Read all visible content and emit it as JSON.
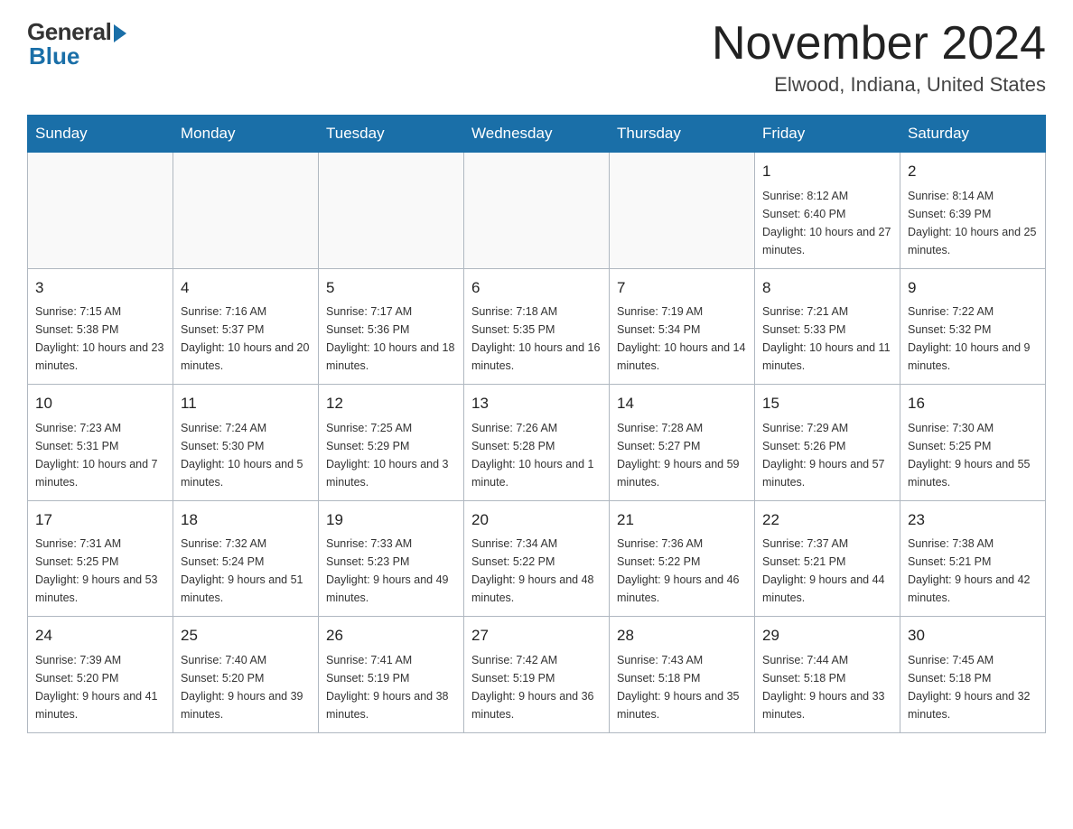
{
  "logo": {
    "general": "General",
    "blue": "Blue"
  },
  "header": {
    "month_year": "November 2024",
    "location": "Elwood, Indiana, United States"
  },
  "weekdays": [
    "Sunday",
    "Monday",
    "Tuesday",
    "Wednesday",
    "Thursday",
    "Friday",
    "Saturday"
  ],
  "weeks": [
    [
      {
        "day": "",
        "info": ""
      },
      {
        "day": "",
        "info": ""
      },
      {
        "day": "",
        "info": ""
      },
      {
        "day": "",
        "info": ""
      },
      {
        "day": "",
        "info": ""
      },
      {
        "day": "1",
        "info": "Sunrise: 8:12 AM\nSunset: 6:40 PM\nDaylight: 10 hours and 27 minutes."
      },
      {
        "day": "2",
        "info": "Sunrise: 8:14 AM\nSunset: 6:39 PM\nDaylight: 10 hours and 25 minutes."
      }
    ],
    [
      {
        "day": "3",
        "info": "Sunrise: 7:15 AM\nSunset: 5:38 PM\nDaylight: 10 hours and 23 minutes."
      },
      {
        "day": "4",
        "info": "Sunrise: 7:16 AM\nSunset: 5:37 PM\nDaylight: 10 hours and 20 minutes."
      },
      {
        "day": "5",
        "info": "Sunrise: 7:17 AM\nSunset: 5:36 PM\nDaylight: 10 hours and 18 minutes."
      },
      {
        "day": "6",
        "info": "Sunrise: 7:18 AM\nSunset: 5:35 PM\nDaylight: 10 hours and 16 minutes."
      },
      {
        "day": "7",
        "info": "Sunrise: 7:19 AM\nSunset: 5:34 PM\nDaylight: 10 hours and 14 minutes."
      },
      {
        "day": "8",
        "info": "Sunrise: 7:21 AM\nSunset: 5:33 PM\nDaylight: 10 hours and 11 minutes."
      },
      {
        "day": "9",
        "info": "Sunrise: 7:22 AM\nSunset: 5:32 PM\nDaylight: 10 hours and 9 minutes."
      }
    ],
    [
      {
        "day": "10",
        "info": "Sunrise: 7:23 AM\nSunset: 5:31 PM\nDaylight: 10 hours and 7 minutes."
      },
      {
        "day": "11",
        "info": "Sunrise: 7:24 AM\nSunset: 5:30 PM\nDaylight: 10 hours and 5 minutes."
      },
      {
        "day": "12",
        "info": "Sunrise: 7:25 AM\nSunset: 5:29 PM\nDaylight: 10 hours and 3 minutes."
      },
      {
        "day": "13",
        "info": "Sunrise: 7:26 AM\nSunset: 5:28 PM\nDaylight: 10 hours and 1 minute."
      },
      {
        "day": "14",
        "info": "Sunrise: 7:28 AM\nSunset: 5:27 PM\nDaylight: 9 hours and 59 minutes."
      },
      {
        "day": "15",
        "info": "Sunrise: 7:29 AM\nSunset: 5:26 PM\nDaylight: 9 hours and 57 minutes."
      },
      {
        "day": "16",
        "info": "Sunrise: 7:30 AM\nSunset: 5:25 PM\nDaylight: 9 hours and 55 minutes."
      }
    ],
    [
      {
        "day": "17",
        "info": "Sunrise: 7:31 AM\nSunset: 5:25 PM\nDaylight: 9 hours and 53 minutes."
      },
      {
        "day": "18",
        "info": "Sunrise: 7:32 AM\nSunset: 5:24 PM\nDaylight: 9 hours and 51 minutes."
      },
      {
        "day": "19",
        "info": "Sunrise: 7:33 AM\nSunset: 5:23 PM\nDaylight: 9 hours and 49 minutes."
      },
      {
        "day": "20",
        "info": "Sunrise: 7:34 AM\nSunset: 5:22 PM\nDaylight: 9 hours and 48 minutes."
      },
      {
        "day": "21",
        "info": "Sunrise: 7:36 AM\nSunset: 5:22 PM\nDaylight: 9 hours and 46 minutes."
      },
      {
        "day": "22",
        "info": "Sunrise: 7:37 AM\nSunset: 5:21 PM\nDaylight: 9 hours and 44 minutes."
      },
      {
        "day": "23",
        "info": "Sunrise: 7:38 AM\nSunset: 5:21 PM\nDaylight: 9 hours and 42 minutes."
      }
    ],
    [
      {
        "day": "24",
        "info": "Sunrise: 7:39 AM\nSunset: 5:20 PM\nDaylight: 9 hours and 41 minutes."
      },
      {
        "day": "25",
        "info": "Sunrise: 7:40 AM\nSunset: 5:20 PM\nDaylight: 9 hours and 39 minutes."
      },
      {
        "day": "26",
        "info": "Sunrise: 7:41 AM\nSunset: 5:19 PM\nDaylight: 9 hours and 38 minutes."
      },
      {
        "day": "27",
        "info": "Sunrise: 7:42 AM\nSunset: 5:19 PM\nDaylight: 9 hours and 36 minutes."
      },
      {
        "day": "28",
        "info": "Sunrise: 7:43 AM\nSunset: 5:18 PM\nDaylight: 9 hours and 35 minutes."
      },
      {
        "day": "29",
        "info": "Sunrise: 7:44 AM\nSunset: 5:18 PM\nDaylight: 9 hours and 33 minutes."
      },
      {
        "day": "30",
        "info": "Sunrise: 7:45 AM\nSunset: 5:18 PM\nDaylight: 9 hours and 32 minutes."
      }
    ]
  ]
}
